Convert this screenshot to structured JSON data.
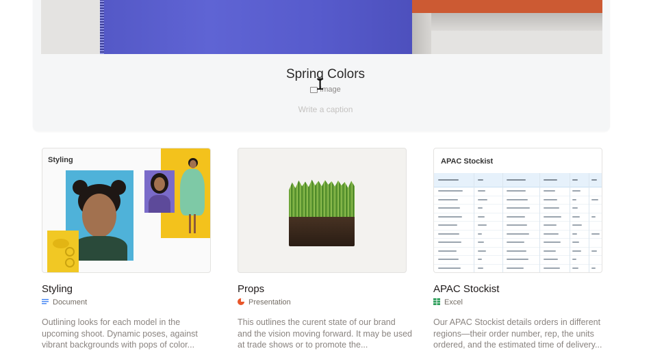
{
  "featured": {
    "title": "Spring Colors",
    "type_label": "Image",
    "caption_placeholder": "Write a caption"
  },
  "cards": [
    {
      "title": "Styling",
      "thumb_label": "Styling",
      "type": "Document",
      "type_color": "#4a8af4",
      "description": "Outlining looks for each model in the upcoming shoot. Dynamic poses, against vibrant backgrounds with pops of color..."
    },
    {
      "title": "Props",
      "type": "Presentation",
      "type_color": "#e8562a",
      "description": "This outlines the curent state of our brand and the vision moving forward. It may be used at trade shows or to promote the..."
    },
    {
      "title": "APAC Stockist",
      "thumb_label": "APAC Stockist",
      "type": "Excel",
      "type_color": "#2e9e5b",
      "description": "Our APAC Stockist details orders in different regions—their order number, rep, the units ordered, and the estimated time of delivery..."
    }
  ],
  "colors": {
    "hero_blue": "#5a5fcf",
    "hero_orange": "#cc5a33"
  }
}
